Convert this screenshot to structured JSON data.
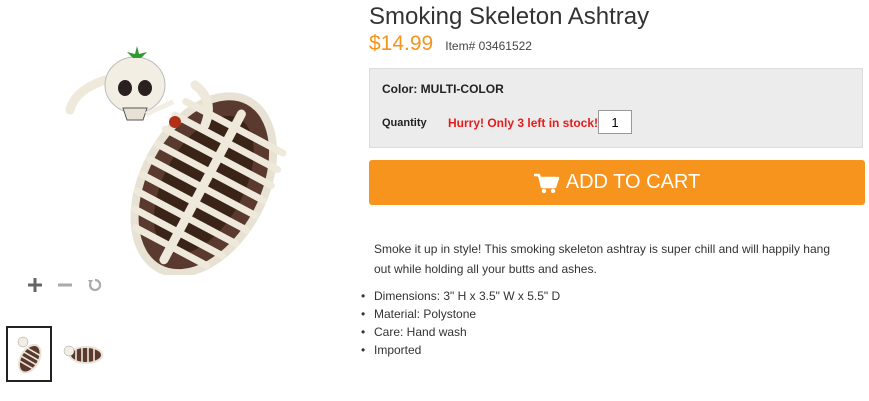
{
  "product": {
    "title": "Smoking Skeleton Ashtray",
    "price": "$14.99",
    "item_number": "Item# 03461522"
  },
  "options": {
    "color_label": "Color: MULTI-COLOR",
    "quantity_label": "Quantity",
    "stock_message": "Hurry! Only 3 left in stock!",
    "quantity_value": "1"
  },
  "cart": {
    "label": "ADD TO CART"
  },
  "description": "Smoke it up in style! This smoking skeleton ashtray is super chill and will happily hang out while holding all your butts and ashes.",
  "specs": [
    "Dimensions: 3\" H x 3.5\" W x 5.5\" D",
    "Material: Polystone",
    "Care: Hand wash",
    "Imported"
  ],
  "colors": {
    "price": "#f5941e",
    "button": "#f7941d",
    "stock": "#e51c1c"
  }
}
